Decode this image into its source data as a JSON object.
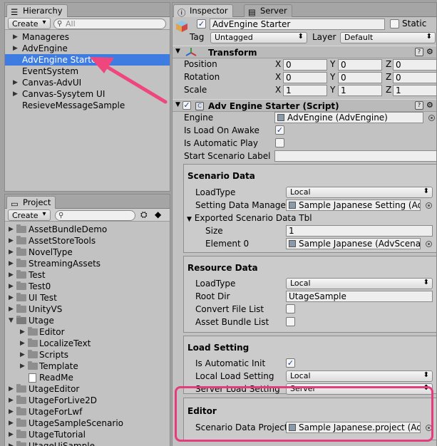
{
  "hierarchy": {
    "tab_label": "Hierarchy",
    "create_label": "Create",
    "search_placeholder": "All",
    "items": [
      {
        "label": "Manageres"
      },
      {
        "label": "AdvEngine"
      },
      {
        "label": "AdvEngine Starter"
      },
      {
        "label": "EventSystem"
      },
      {
        "label": "Canvas-AdvUI"
      },
      {
        "label": "Canvas-Sysytem UI"
      },
      {
        "label": "ResieveMessageSample"
      }
    ]
  },
  "project": {
    "tab_label": "Project",
    "create_label": "Create",
    "items": [
      {
        "label": "AssetBundleDemo"
      },
      {
        "label": "AssetStoreTools"
      },
      {
        "label": "NovelType"
      },
      {
        "label": "StreamingAssets"
      },
      {
        "label": "Test"
      },
      {
        "label": "Test0"
      },
      {
        "label": "UI Test"
      },
      {
        "label": "UnityVS"
      },
      {
        "label": "Utage"
      },
      {
        "label": "Editor"
      },
      {
        "label": "LocalizeText"
      },
      {
        "label": "Scripts"
      },
      {
        "label": "Template"
      },
      {
        "label": "ReadMe"
      },
      {
        "label": "UtageEditor"
      },
      {
        "label": "UtageForLive2D"
      },
      {
        "label": "UtageForLwf"
      },
      {
        "label": "UtageSampleScenario"
      },
      {
        "label": "UtageTutorial"
      },
      {
        "label": "UtageUiSample"
      }
    ]
  },
  "inspector": {
    "tab_label": "Inspector",
    "server_tab_label": "Server",
    "object_name": "AdvEngine Starter",
    "static_label": "Static",
    "tag_label": "Tag",
    "tag_value": "Untagged",
    "layer_label": "Layer",
    "layer_value": "Default",
    "transform": {
      "title": "Transform",
      "position_label": "Position",
      "rotation_label": "Rotation",
      "scale_label": "Scale",
      "axis_x": "X",
      "axis_y": "Y",
      "axis_z": "Z",
      "position": [
        "0",
        "0",
        "0"
      ],
      "rotation": [
        "0",
        "0",
        "0"
      ],
      "scale": [
        "1",
        "1",
        "1"
      ]
    },
    "script": {
      "title": "Adv Engine Starter (Script)",
      "engine_label": "Engine",
      "engine_value": "AdvEngine (AdvEngine)",
      "load_on_awake_label": "Is Load On Awake",
      "auto_play_label": "Is Automatic Play",
      "start_label_label": "Start Scenario Label",
      "start_label_value": ""
    },
    "scenario_data": {
      "title": "Scenario Data",
      "load_type_label": "LoadType",
      "load_type_value": "Local",
      "setting_label": "Setting Data Manager",
      "setting_value": "Sample Japanese Setting (Adv",
      "exported_label": "Exported Scenario Data Tbl",
      "size_label": "Size",
      "size_value": "1",
      "element0_label": "Element 0",
      "element0_value": "Sample Japanese (AdvScenar"
    },
    "resource_data": {
      "title": "Resource Data",
      "load_type_label": "LoadType",
      "load_type_value": "Local",
      "root_dir_label": "Root Dir",
      "root_dir_value": "UtageSample",
      "convert_label": "Convert File List",
      "bundle_label": "Asset Bundle List"
    },
    "load_setting": {
      "title": "Load Setting",
      "auto_init_label": "Is Automatic Init",
      "local_label": "Local Load Setting",
      "local_value": "Local",
      "server_label": "Server Load Setting",
      "server_value": "Server"
    },
    "editor": {
      "title": "Editor",
      "project_label": "Scenario Data Project",
      "project_value": "Sample Japanese.project (Adv"
    }
  },
  "colors": {
    "selection": "#3e7ce2",
    "highlight": "#e43c7c",
    "arrow": "#f0467e"
  }
}
